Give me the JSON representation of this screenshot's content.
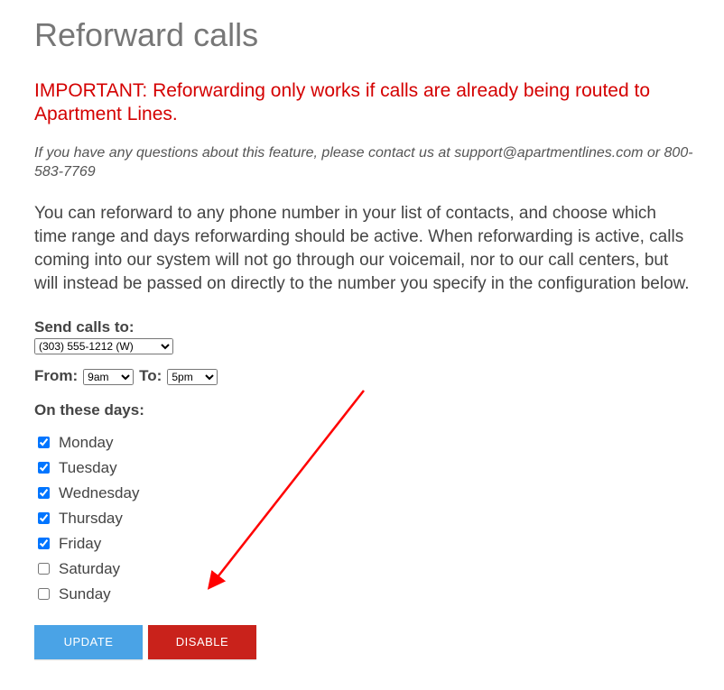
{
  "title": "Reforward calls",
  "important_note": "IMPORTANT: Reforwarding only works if calls are already being routed to Apartment Lines.",
  "contact_note": "If you have any questions about this feature, please contact us at support@apartmentlines.com or 800-583-7769",
  "description": "You can reforward to any phone number in your list of contacts, and choose which time range and days reforwarding should be active. When reforwarding is active, calls coming into our system will not go through our voicemail, nor to our call centers, but will instead be passed on directly to the number you specify in the configuration below.",
  "send_calls_to_label": "Send calls to:",
  "phone_selected": "(303) 555-1212 (W)",
  "from_label": "From:",
  "to_label": "To:",
  "from_time": "9am",
  "to_time": "5pm",
  "days_label": "On these days:",
  "days": [
    {
      "label": "Monday",
      "checked": true
    },
    {
      "label": "Tuesday",
      "checked": true
    },
    {
      "label": "Wednesday",
      "checked": true
    },
    {
      "label": "Thursday",
      "checked": true
    },
    {
      "label": "Friday",
      "checked": true
    },
    {
      "label": "Saturday",
      "checked": false
    },
    {
      "label": "Sunday",
      "checked": false
    }
  ],
  "buttons": {
    "update_label": "UPDATE",
    "disable_label": "DISABLE"
  },
  "colors": {
    "important": "#d40000",
    "update_btn": "#4aa3e6",
    "disable_btn": "#c9221b",
    "arrow": "#ff0000"
  }
}
